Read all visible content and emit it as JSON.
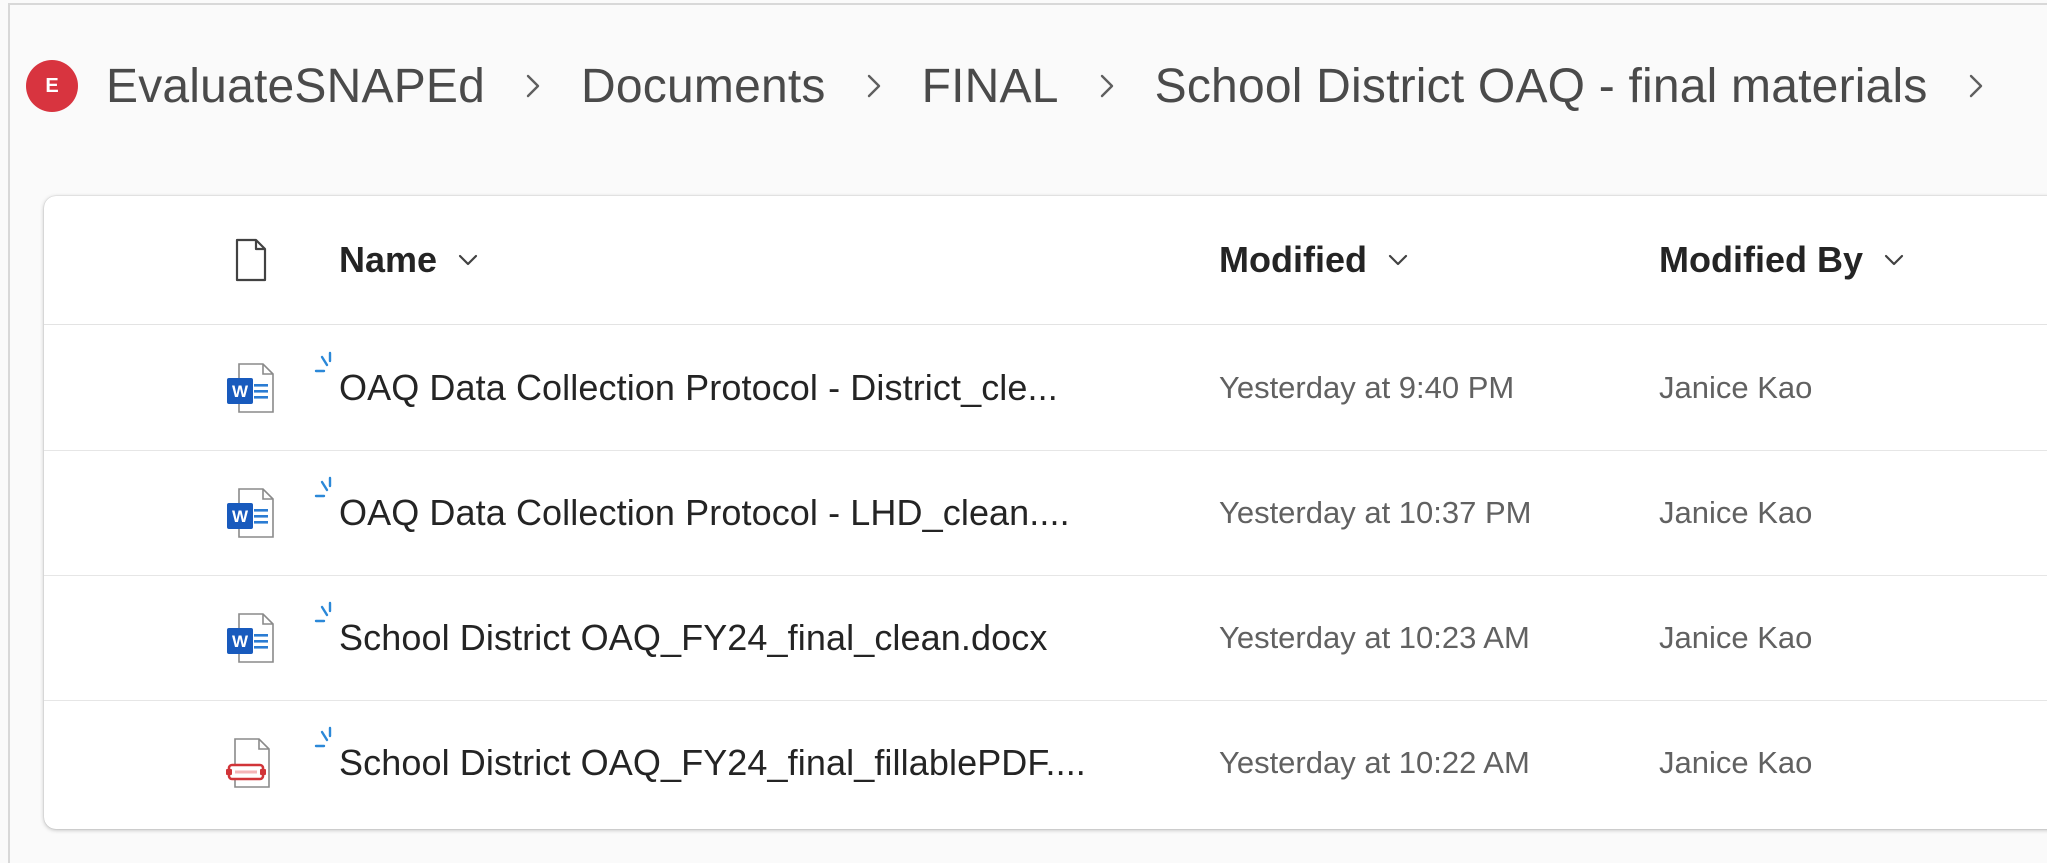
{
  "breadcrumb": {
    "site_initial": "E",
    "items": [
      "EvaluateSNAPEd",
      "Documents",
      "FINAL",
      "School District OAQ - final materials"
    ]
  },
  "list": {
    "columns": {
      "name": "Name",
      "modified": "Modified",
      "modified_by": "Modified By"
    },
    "rows": [
      {
        "icon": "word-doc-icon",
        "name": "OAQ Data Collection Protocol - District_cle...",
        "modified": "Yesterday at 9:40 PM",
        "modified_by": "Janice Kao"
      },
      {
        "icon": "word-doc-icon",
        "name": "OAQ Data Collection Protocol - LHD_clean....",
        "modified": "Yesterday at 10:37 PM",
        "modified_by": "Janice Kao"
      },
      {
        "icon": "word-doc-icon",
        "name": "School District OAQ_FY24_final_clean.docx",
        "modified": "Yesterday at 10:23 AM",
        "modified_by": "Janice Kao"
      },
      {
        "icon": "pdf-doc-icon",
        "name": "School District OAQ_FY24_final_fillablePDF....",
        "modified": "Yesterday at 10:22 AM",
        "modified_by": "Janice Kao"
      }
    ]
  },
  "colors": {
    "site_badge": "#d8343f",
    "word_blue": "#185abd",
    "pdf_red": "#d13438",
    "new_badge_blue": "#2b88d8"
  }
}
